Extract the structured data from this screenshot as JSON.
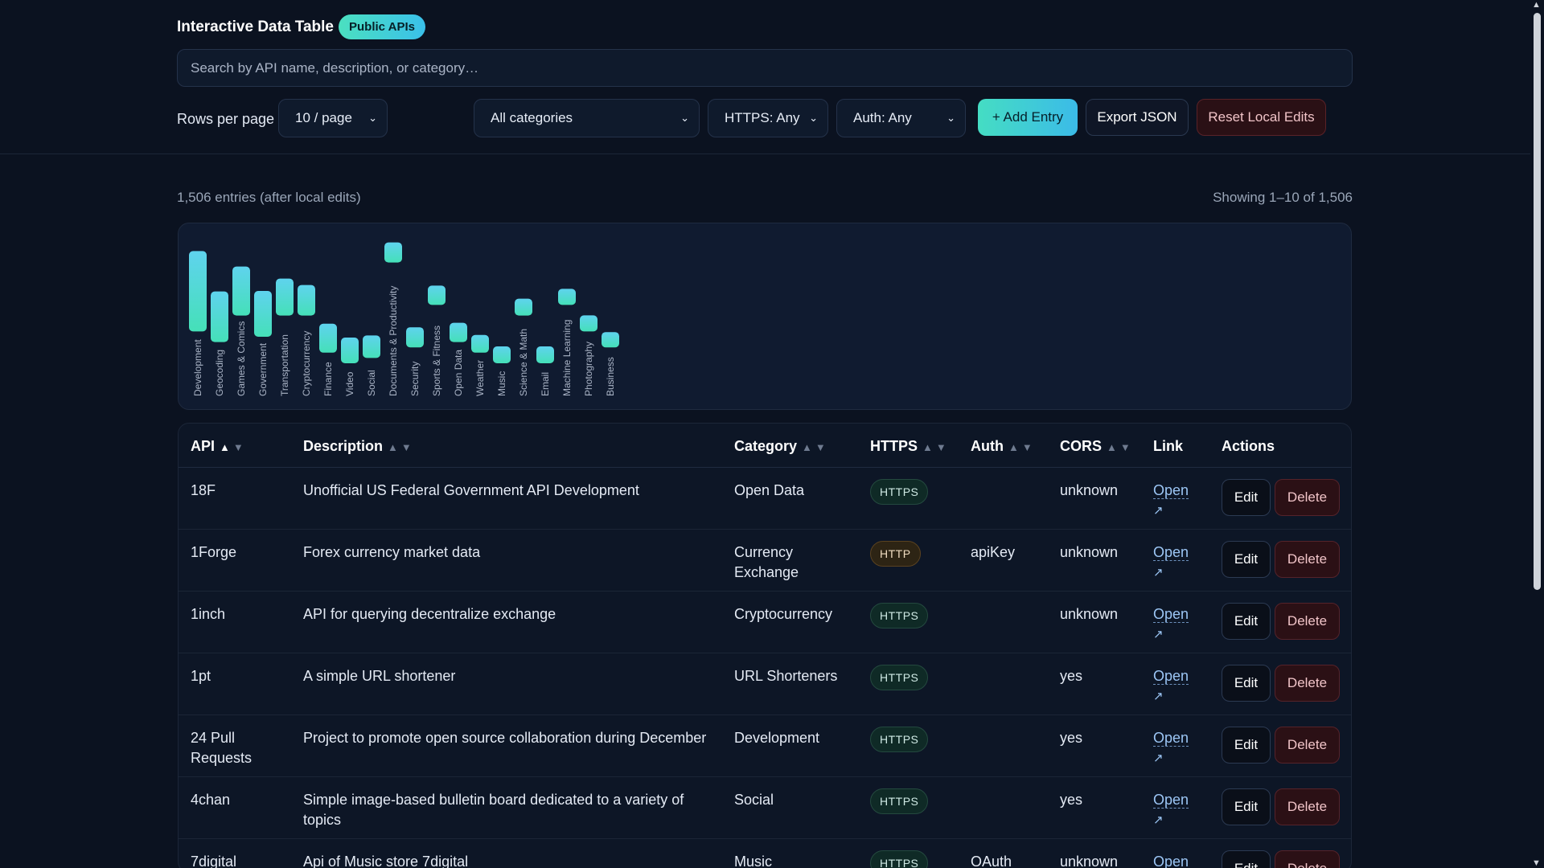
{
  "header": {
    "title": "Interactive Data Table",
    "badge": "Public APIs",
    "search_placeholder": "Search by API name, description, or category…",
    "rows_per_page_label": "Rows per page",
    "rows_per_page_value": "10 / page",
    "category_filter": "All categories",
    "https_filter": "HTTPS: Any",
    "auth_filter": "Auth: Any",
    "add_label": "+ Add Entry",
    "export_label": "Export JSON",
    "reset_label": "Reset Local Edits"
  },
  "summary": {
    "entries": "1,506 entries (after local edits)",
    "showing": "Showing 1–10 of 1,506"
  },
  "chart_data": {
    "type": "bar",
    "categories": [
      "Development",
      "Geocoding",
      "Games & Comics",
      "Government",
      "Transportation",
      "Cryptocurrency",
      "Finance",
      "Video",
      "Social",
      "Documents & Productivity",
      "Security",
      "Sports & Fitness",
      "Open Data",
      "Weather",
      "Music",
      "Science & Math",
      "Email",
      "Machine Learning",
      "Photography",
      "Business"
    ],
    "values": [
      100,
      63,
      61,
      57,
      46,
      38,
      36,
      32,
      28,
      25,
      25,
      24,
      24,
      22,
      21,
      21,
      21,
      20,
      20,
      19
    ],
    "colors": {
      "top": "#7ce6e8",
      "bottom": "#3ad6b0",
      "side": "#3bbbe8"
    }
  },
  "table": {
    "headers": {
      "api": "API",
      "description": "Description",
      "category": "Category",
      "https": "HTTPS",
      "auth": "Auth",
      "cors": "CORS",
      "link": "Link",
      "actions": "Actions"
    },
    "link_label": "Open",
    "link_arrow": "↗",
    "edit_label": "Edit",
    "delete_label": "Delete",
    "rows": [
      {
        "api": "18F",
        "description": "Unofficial US Federal Government API Development",
        "category": "Open Data",
        "https": "HTTPS",
        "auth": "",
        "cors": "unknown"
      },
      {
        "api": "1Forge",
        "description": "Forex currency market data",
        "category": "Currency Exchange",
        "https": "HTTP",
        "auth": "apiKey",
        "cors": "unknown"
      },
      {
        "api": "1inch",
        "description": "API for querying decentralize exchange",
        "category": "Cryptocurrency",
        "https": "HTTPS",
        "auth": "",
        "cors": "unknown"
      },
      {
        "api": "1pt",
        "description": "A simple URL shortener",
        "category": "URL Shorteners",
        "https": "HTTPS",
        "auth": "",
        "cors": "yes"
      },
      {
        "api": "24 Pull Requests",
        "description": "Project to promote open source collaboration during December",
        "category": "Development",
        "https": "HTTPS",
        "auth": "",
        "cors": "yes"
      },
      {
        "api": "4chan",
        "description": "Simple image-based bulletin board dedicated to a variety of topics",
        "category": "Social",
        "https": "HTTPS",
        "auth": "",
        "cors": "yes"
      },
      {
        "api": "7digital",
        "description": "Api of Music store 7digital",
        "category": "Music",
        "https": "HTTPS",
        "auth": "OAuth",
        "cors": "unknown"
      }
    ]
  }
}
